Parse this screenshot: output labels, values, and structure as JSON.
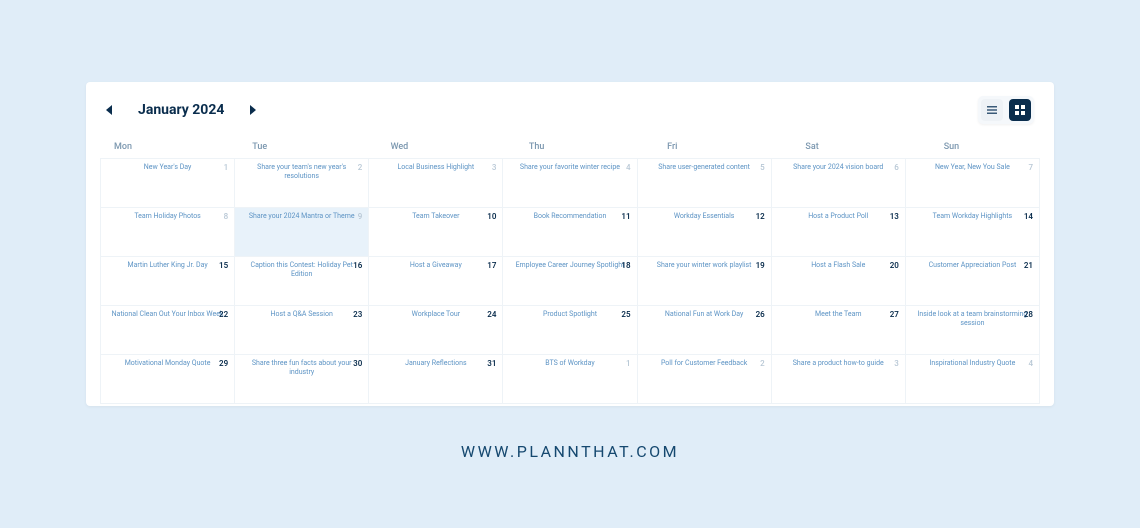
{
  "header": {
    "month_title": "January 2024"
  },
  "days_of_week": [
    "Mon",
    "Tue",
    "Wed",
    "Thu",
    "Fri",
    "Sat",
    "Sun"
  ],
  "cells": [
    {
      "day": "1",
      "muted": true,
      "event": "New Year's Day",
      "hl": false
    },
    {
      "day": "2",
      "muted": true,
      "event": "Share your team's new year's resolutions",
      "hl": false
    },
    {
      "day": "3",
      "muted": true,
      "event": "Local Business Highlight",
      "hl": false
    },
    {
      "day": "4",
      "muted": true,
      "event": "Share your favorite winter recipe",
      "hl": false
    },
    {
      "day": "5",
      "muted": true,
      "event": "Share user-generated content",
      "hl": false
    },
    {
      "day": "6",
      "muted": true,
      "event": "Share your 2024 vision board",
      "hl": false
    },
    {
      "day": "7",
      "muted": true,
      "event": "New Year, New You Sale",
      "hl": false
    },
    {
      "day": "8",
      "muted": true,
      "event": "Team Holiday Photos",
      "hl": false
    },
    {
      "day": "9",
      "muted": true,
      "event": "Share your 2024 Mantra or Theme",
      "hl": true
    },
    {
      "day": "10",
      "muted": false,
      "event": "Team Takeover",
      "hl": false
    },
    {
      "day": "11",
      "muted": false,
      "event": "Book Recommendation",
      "hl": false
    },
    {
      "day": "12",
      "muted": false,
      "event": "Workday Essentials",
      "hl": false
    },
    {
      "day": "13",
      "muted": false,
      "event": "Host a Product Poll",
      "hl": false
    },
    {
      "day": "14",
      "muted": false,
      "event": "Team Workday Highlights",
      "hl": false
    },
    {
      "day": "15",
      "muted": false,
      "event": "Martin Luther King Jr. Day",
      "hl": false
    },
    {
      "day": "16",
      "muted": false,
      "event": "Caption this Contest: Holiday Pet Edition",
      "hl": false
    },
    {
      "day": "17",
      "muted": false,
      "event": "Host a Giveaway",
      "hl": false
    },
    {
      "day": "18",
      "muted": false,
      "event": "Employee Career Journey Spotlight",
      "hl": false
    },
    {
      "day": "19",
      "muted": false,
      "event": "Share your winter work playlist",
      "hl": false
    },
    {
      "day": "20",
      "muted": false,
      "event": "Host a Flash Sale",
      "hl": false
    },
    {
      "day": "21",
      "muted": false,
      "event": "Customer Appreciation Post",
      "hl": false
    },
    {
      "day": "22",
      "muted": false,
      "event": "National Clean Out Your Inbox Week",
      "hl": false
    },
    {
      "day": "23",
      "muted": false,
      "event": "Host a Q&A Session",
      "hl": false
    },
    {
      "day": "24",
      "muted": false,
      "event": "Workplace Tour",
      "hl": false
    },
    {
      "day": "25",
      "muted": false,
      "event": "Product Spotlight",
      "hl": false
    },
    {
      "day": "26",
      "muted": false,
      "event": "National Fun at Work Day",
      "hl": false
    },
    {
      "day": "27",
      "muted": false,
      "event": "Meet the Team",
      "hl": false
    },
    {
      "day": "28",
      "muted": false,
      "event": "Inside look at a team brainstorming session",
      "hl": false
    },
    {
      "day": "29",
      "muted": false,
      "event": "Motivational Monday Quote",
      "hl": false
    },
    {
      "day": "30",
      "muted": false,
      "event": "Share three fun facts about your industry",
      "hl": false
    },
    {
      "day": "31",
      "muted": false,
      "event": "January Reflections",
      "hl": false
    },
    {
      "day": "1",
      "muted": true,
      "event": "BTS of Workday",
      "hl": false
    },
    {
      "day": "2",
      "muted": true,
      "event": "Poll for Customer Feedback",
      "hl": false
    },
    {
      "day": "3",
      "muted": true,
      "event": "Share a product how-to guide",
      "hl": false
    },
    {
      "day": "4",
      "muted": true,
      "event": "Inspirational Industry Quote",
      "hl": false
    }
  ],
  "footer": {
    "url_text": "WWW.PLANNTHAT.COM"
  }
}
